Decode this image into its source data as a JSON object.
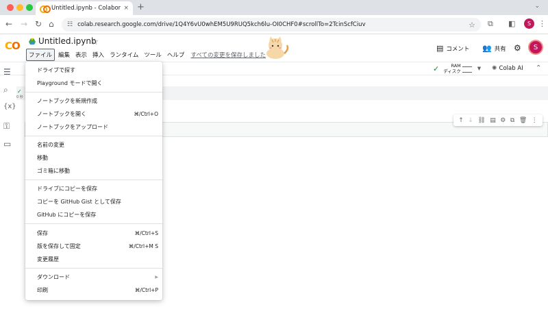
{
  "browser": {
    "tab_title": "Untitled.ipynb - Colaboratory",
    "tab_close": "×",
    "new_tab": "+",
    "url": "colab.research.google.com/drive/1Q4Y6vU0whEM5U9RUQ5kch6lu-OI0CHF0#scrollTo=2TcinScfCiuv",
    "profile_initial": "S"
  },
  "header": {
    "logo": "CO",
    "notebook_title": "Untitled.ipynb",
    "menus": [
      "ファイル",
      "編集",
      "表示",
      "挿入",
      "ランタイム",
      "ツール",
      "ヘルプ"
    ],
    "save_all": "すべての変更を保存しました",
    "comment": "コメント",
    "share": "共有",
    "avatar_initial": "S"
  },
  "toolbar": {
    "ram_label": "RAM",
    "disk_label": "ディスク",
    "colab_ai": "Colab AI"
  },
  "cell": {
    "run_time": "0 秒"
  },
  "file_menu": {
    "items": [
      {
        "label": "ドライブで探す",
        "shortcut": ""
      },
      {
        "label": "Playground モードで開く",
        "shortcut": ""
      },
      {
        "label": "ノートブックを新規作成",
        "shortcut": ""
      },
      {
        "label": "ノートブックを開く",
        "shortcut": "⌘/Ctrl+O"
      },
      {
        "label": "ノートブックをアップロード",
        "shortcut": ""
      },
      {
        "label": "名前の変更",
        "shortcut": ""
      },
      {
        "label": "移動",
        "shortcut": ""
      },
      {
        "label": "ゴミ箱に移動",
        "shortcut": ""
      },
      {
        "label": "ドライブにコピーを保存",
        "shortcut": ""
      },
      {
        "label": "コピーを GitHub Gist として保存",
        "shortcut": ""
      },
      {
        "label": "GitHub にコピーを保存",
        "shortcut": ""
      },
      {
        "label": "保存",
        "shortcut": "⌘/Ctrl+S"
      },
      {
        "label": "版を保存して固定",
        "shortcut": "⌘/Ctrl+M S"
      },
      {
        "label": "変更履歴",
        "shortcut": ""
      },
      {
        "label": "ダウンロード",
        "shortcut": ""
      },
      {
        "label": "印刷",
        "shortcut": "⌘/Ctrl+P"
      }
    ]
  },
  "colors": {
    "accent_orange": "#f9ab00",
    "accent_dark_orange": "#e8710a",
    "profile": "#c2185b",
    "success": "#188038"
  }
}
